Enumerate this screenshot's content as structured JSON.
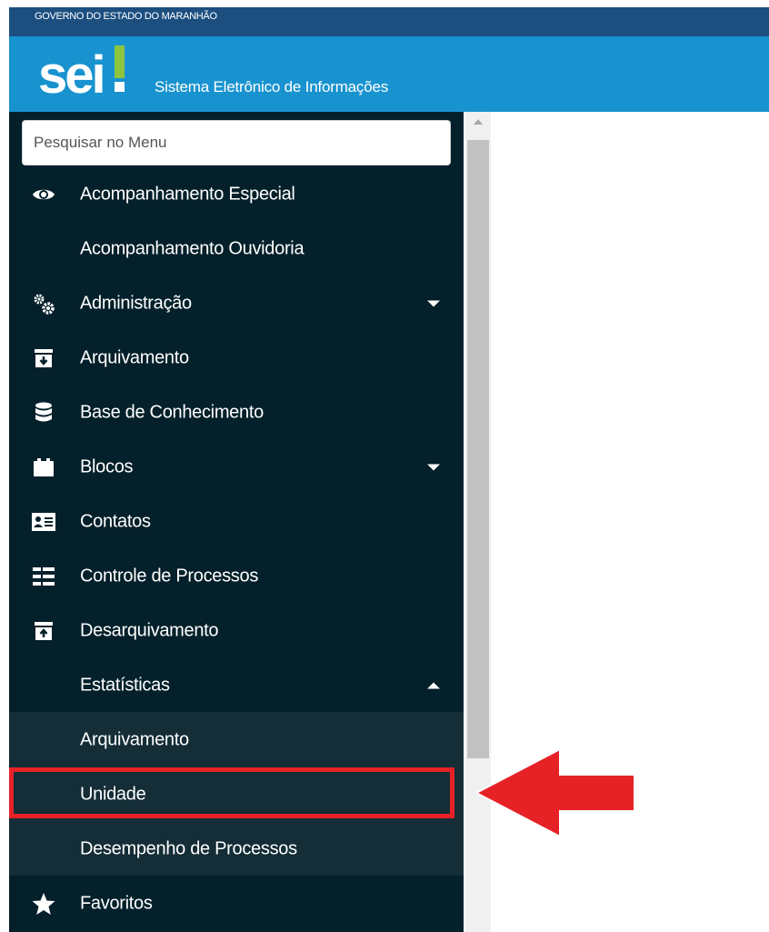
{
  "gov_label": "GOVERNO DO ESTADO DO MARANHÃO",
  "logo_text": "sei!",
  "system_name": "Sistema Eletrônico de Informações",
  "search": {
    "placeholder": "Pesquisar no Menu"
  },
  "colors": {
    "gov_bar": "#1c4f80",
    "header": "#1993cf",
    "sidebar": "#04202a",
    "submenu": "#142d37",
    "highlight": "#e62227",
    "logo_accent": "#8cc63f"
  },
  "menu": [
    {
      "label": "Acompanhamento Especial",
      "icon": "eye-icon"
    },
    {
      "label": "Acompanhamento Ouvidoria",
      "icon": ""
    },
    {
      "label": "Administração",
      "icon": "gears-icon",
      "caret": "down"
    },
    {
      "label": "Arquivamento",
      "icon": "archive-down-icon"
    },
    {
      "label": "Base de Conhecimento",
      "icon": "database-icon"
    },
    {
      "label": "Blocos",
      "icon": "briefcase-icon",
      "caret": "down"
    },
    {
      "label": "Contatos",
      "icon": "contact-card-icon"
    },
    {
      "label": "Controle de Processos",
      "icon": "list-icon"
    },
    {
      "label": "Desarquivamento",
      "icon": "archive-up-icon"
    },
    {
      "label": "Estatísticas",
      "icon": "",
      "caret": "up"
    },
    {
      "label": "Arquivamento",
      "icon": "",
      "submenu": true
    },
    {
      "label": "Unidade",
      "icon": "",
      "submenu": true,
      "highlighted": true
    },
    {
      "label": "Desempenho de Processos",
      "icon": "",
      "submenu": true
    },
    {
      "label": "Favoritos",
      "icon": "star-icon"
    }
  ]
}
